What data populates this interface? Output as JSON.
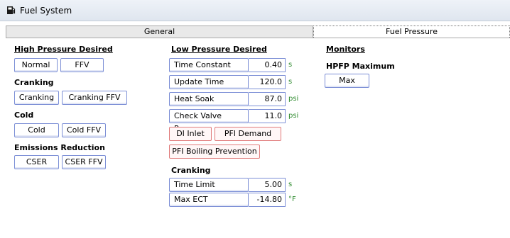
{
  "window": {
    "title": "Fuel System"
  },
  "tabs": [
    {
      "label": "General",
      "active": false
    },
    {
      "label": "Fuel Pressure",
      "active": true
    }
  ],
  "high_pressure": {
    "heading": "High Pressure Desired",
    "buttons": [
      "Normal",
      "FFV"
    ],
    "cranking": {
      "heading": "Cranking",
      "buttons": [
        "Cranking",
        "Cranking FFV"
      ]
    },
    "cold": {
      "heading": "Cold",
      "buttons": [
        "Cold",
        "Cold FFV"
      ]
    },
    "emissions": {
      "heading": "Emissions Reduction",
      "buttons": [
        "CSER",
        "CSER FFV"
      ]
    }
  },
  "low_pressure": {
    "heading": "Low Pressure Desired",
    "rows": [
      {
        "label": "Time Constant",
        "value": "0.40",
        "unit": "s"
      },
      {
        "label": "Update Time",
        "value": "120.0",
        "unit": "s"
      },
      {
        "label": "Heat Soak",
        "value": "87.0",
        "unit": "psi"
      },
      {
        "label": "Check Valve Pressure",
        "value": "11.0",
        "unit": "psi"
      }
    ],
    "red_buttons": [
      "DI Inlet",
      "PFI Demand",
      "PFI Boiling Prevention"
    ],
    "cranking": {
      "heading": "Cranking",
      "rows": [
        {
          "label": "Time Limit",
          "value": "5.00",
          "unit": "s"
        },
        {
          "label": "Max ECT",
          "value": "-14.80",
          "unit": "°F"
        }
      ]
    }
  },
  "monitors": {
    "heading": "Monitors",
    "hpfp": {
      "heading": "HPFP Maximum",
      "button": "Max"
    }
  },
  "colors": {
    "button_border": "#7c8fd6",
    "red_button_border": "#e07b7b",
    "unit_text": "#2e8b2e"
  }
}
